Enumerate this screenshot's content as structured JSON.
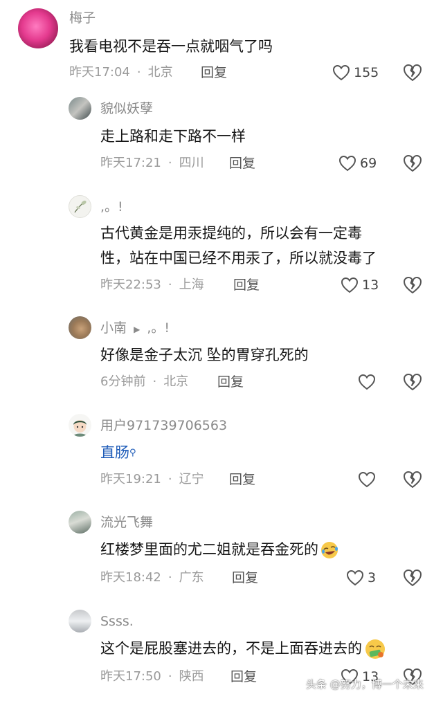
{
  "colors": {
    "avatar_meizi": "#e43a8e",
    "link": "#1d5bb8"
  },
  "comments": [
    {
      "user": "梅子",
      "text": "我看电视不是吞一点就咽气了吗",
      "time": "昨天17:04",
      "location": "北京",
      "reply": "回复",
      "likes": "155"
    },
    {
      "user": "貌似妖孽",
      "text": "走上路和走下路不一样",
      "time": "昨天17:21",
      "location": "四川",
      "reply": "回复",
      "likes": "69"
    },
    {
      "user": ",。!",
      "text_lines": [
        "古代黄金是用汞提纯的，所以会有一定毒",
        "性，站在中国已经不用汞了，所以就没毒了"
      ],
      "time": "昨天22:53",
      "location": "上海",
      "reply": "回复",
      "likes": "13"
    },
    {
      "user": "小南",
      "reply_to": ",。!",
      "text": "好像是金子太沉 坠的胃穿孔死的",
      "time": "6分钟前",
      "location": "北京",
      "reply": "回复",
      "likes": ""
    },
    {
      "user": "用户971739706563",
      "text": "直肠",
      "time": "昨天19:21",
      "location": "辽宁",
      "reply": "回复",
      "likes": ""
    },
    {
      "user": "流光飞舞",
      "text": "红楼梦里面的尤二姐就是吞金死的",
      "time": "昨天18:42",
      "location": "广东",
      "reply": "回复",
      "likes": "3"
    },
    {
      "user": "Ssss.",
      "text": "这个是屁股塞进去的，不是上面吞进去的",
      "time": "昨天17:50",
      "location": "陕西",
      "reply": "回复",
      "likes": "13"
    }
  ],
  "watermark": "头条 @努力，博一个未来"
}
